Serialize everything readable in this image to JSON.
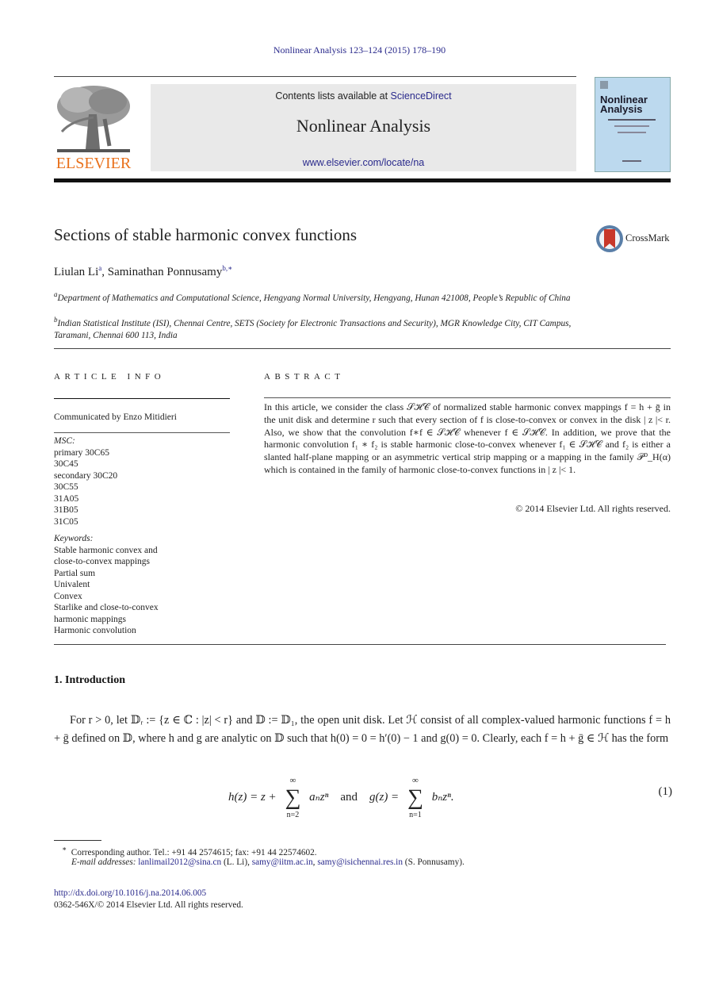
{
  "journal_reference": "Nonlinear Analysis 123–124 (2015) 178–190",
  "header": {
    "publisher_logo_text": "ELSEVIER",
    "contents_prefix": "Contents lists available at ",
    "contents_link": "ScienceDirect",
    "journal_title": "Nonlinear Analysis",
    "journal_url": "www.elsevier.com/locate/na",
    "cover_title_line1": "Nonlinear",
    "cover_title_line2": "Analysis",
    "colors": {
      "link": "#2a2a8c",
      "elsevier_orange": "#e9711c",
      "header_box": "#e9e9e9",
      "cover_blue": "#bcd9ee"
    }
  },
  "article": {
    "title": "Sections of stable harmonic convex functions",
    "crossmark_label": "CrossMark",
    "authors": [
      {
        "name": "Liulan Li",
        "sup": "a"
      },
      {
        "name": "Saminathan Ponnusamy",
        "sup": "b,∗"
      }
    ],
    "author_separator": ", ",
    "affiliations": [
      {
        "label": "a",
        "text": "Department of Mathematics and Computational Science, Hengyang Normal University, Hengyang, Hunan 421008, People’s Republic of China"
      },
      {
        "label": "b",
        "text": "Indian Statistical Institute (ISI), Chennai Centre, SETS (Society for Electronic Transactions and Security), MGR Knowledge City, CIT Campus, Taramani, Chennai 600 113, India"
      }
    ]
  },
  "article_info": {
    "heading": "ARTICLE INFO",
    "communicated": "Communicated by Enzo Mitidieri",
    "msc_label": "MSC:",
    "msc": [
      "primary 30C65",
      "30C45",
      "secondary 30C20",
      "30C55",
      "31A05",
      "31B05",
      "31C05"
    ],
    "keywords_label": "Keywords:",
    "keywords": [
      "Stable harmonic convex and",
      "close-to-convex mappings",
      "Partial sum",
      "Univalent",
      "Convex",
      "Starlike and close-to-convex",
      "harmonic mappings",
      "Harmonic convolution"
    ]
  },
  "abstract": {
    "heading": "ABSTRACT",
    "text": "In this article, we consider the class 𝒮ℋ𝒞 of normalized stable harmonic convex mappings f = h + ḡ in the unit disk and determine r such that every section of f is close-to-convex or convex in the disk | z |< r. Also, we show that the convolution f∗f ∈ 𝒮ℋ𝒞 whenever f ∈ 𝒮ℋ𝒞. In addition, we prove that the harmonic convolution f₁ ∗ f₂ is stable harmonic close-to-convex whenever f₁ ∈ 𝒮ℋ𝒞 and f₂ is either a slanted half-plane mapping or an asymmetric vertical strip mapping or a mapping in the family 𝒫⁰_H(α) which is contained in the family of harmonic close-to-convex functions in | z |< 1.",
    "copyright": "© 2014 Elsevier Ltd. All rights reserved."
  },
  "body": {
    "section_heading": "1.  Introduction",
    "paragraph": "For r > 0, let 𝔻ᵣ := {z ∈ ℂ : |z| < r} and 𝔻 := 𝔻₁, the open unit disk. Let ℋ consist of all complex-valued harmonic functions f = h + ḡ defined on 𝔻, where h and g are analytic on 𝔻 such that h(0) = 0 = h′(0) − 1 and g(0) = 0. Clearly, each f = h + ḡ ∈ ℋ has the form",
    "equation": {
      "lhs1": "h(z) = z + ",
      "sum1_top": "∞",
      "sum1_bottom": "n=2",
      "term1": "aₙzⁿ",
      "connector": "and",
      "lhs2": "g(z) = ",
      "sum2_top": "∞",
      "sum2_bottom": "n=1",
      "term2": "bₙzⁿ.",
      "number": "(1)"
    }
  },
  "footnotes": {
    "corresponding_mark": "∗",
    "corresponding": "Corresponding author. Tel.: +91 44 2574615; fax: +91 44 22574602.",
    "email_label": "E-mail addresses: ",
    "emails": [
      {
        "address": "lanlimail2012@sina.cn",
        "owner": " (L. Li), "
      },
      {
        "address": "samy@iitm.ac.in",
        "owner": ", "
      },
      {
        "address": "samy@isichennai.res.in",
        "owner": " (S. Ponnusamy)."
      }
    ],
    "doi": "http://dx.doi.org/10.1016/j.na.2014.06.005",
    "issn": "0362-546X/© 2014 Elsevier Ltd. All rights reserved."
  }
}
